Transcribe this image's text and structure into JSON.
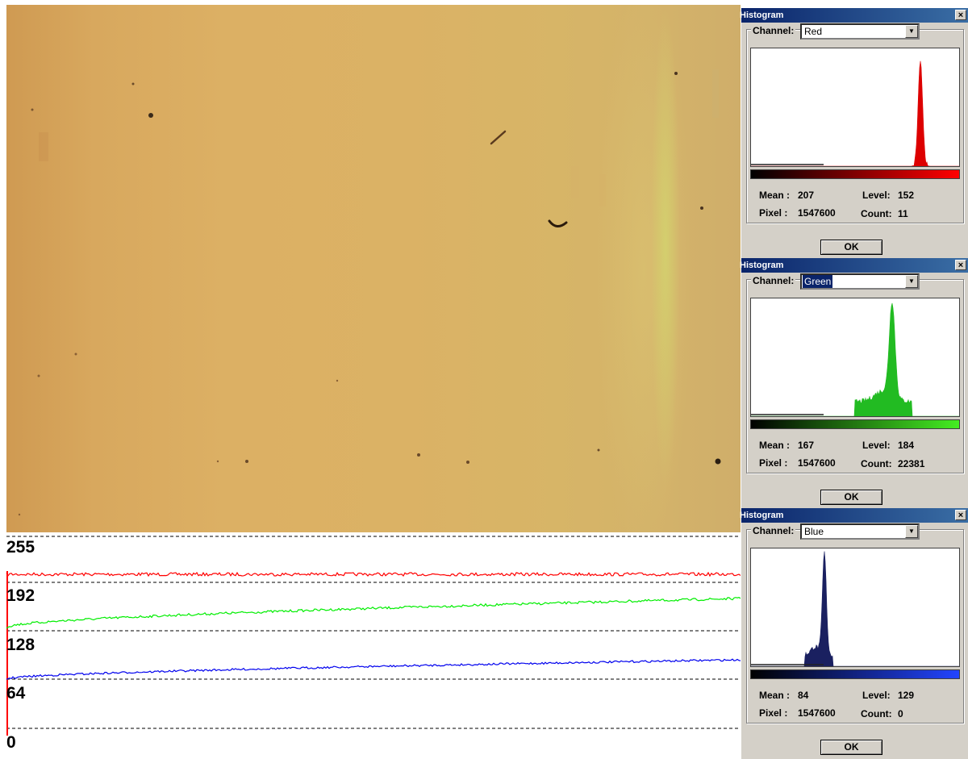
{
  "profile": {
    "tick_labels": [
      "255",
      "192",
      "128",
      "64",
      "0"
    ],
    "colors": {
      "red": "#ff0000",
      "green": "#00ee00",
      "blue": "#0000ee",
      "grid": "#000000"
    }
  },
  "histograms": [
    {
      "title": "Histogram",
      "close_label": "×",
      "channel_label": "Channel:",
      "channel_value": "Red",
      "channel_selected": false,
      "color": "#dd0000",
      "gradient_to": "#ff0000",
      "mean_label": "Mean :",
      "mean": "207",
      "pixel_label": "Pixel :",
      "pixel": "1547600",
      "level_label": "Level:",
      "level": "152",
      "count_label": "Count:",
      "count": "11",
      "ok_label": "OK"
    },
    {
      "title": "Histogram",
      "close_label": "×",
      "channel_label": "Channel:",
      "channel_value": "Green",
      "channel_selected": true,
      "color": "#22bb22",
      "gradient_to": "#44ee22",
      "mean_label": "Mean :",
      "mean": "167",
      "pixel_label": "Pixel :",
      "pixel": "1547600",
      "level_label": "Level:",
      "level": "184",
      "count_label": "Count:",
      "count": "22381",
      "ok_label": "OK"
    },
    {
      "title": "Histogram",
      "close_label": "×",
      "channel_label": "Channel:",
      "channel_value": "Blue",
      "channel_selected": false,
      "color": "#1a2060",
      "gradient_to": "#2244ff",
      "mean_label": "Mean :",
      "mean": "84",
      "pixel_label": "Pixel :",
      "pixel": "1547600",
      "level_label": "Level:",
      "level": "129",
      "count_label": "Count:",
      "count": "0",
      "ok_label": "OK"
    }
  ],
  "icons": {
    "close": "close-icon",
    "dropdown": "chevron-down-icon"
  }
}
